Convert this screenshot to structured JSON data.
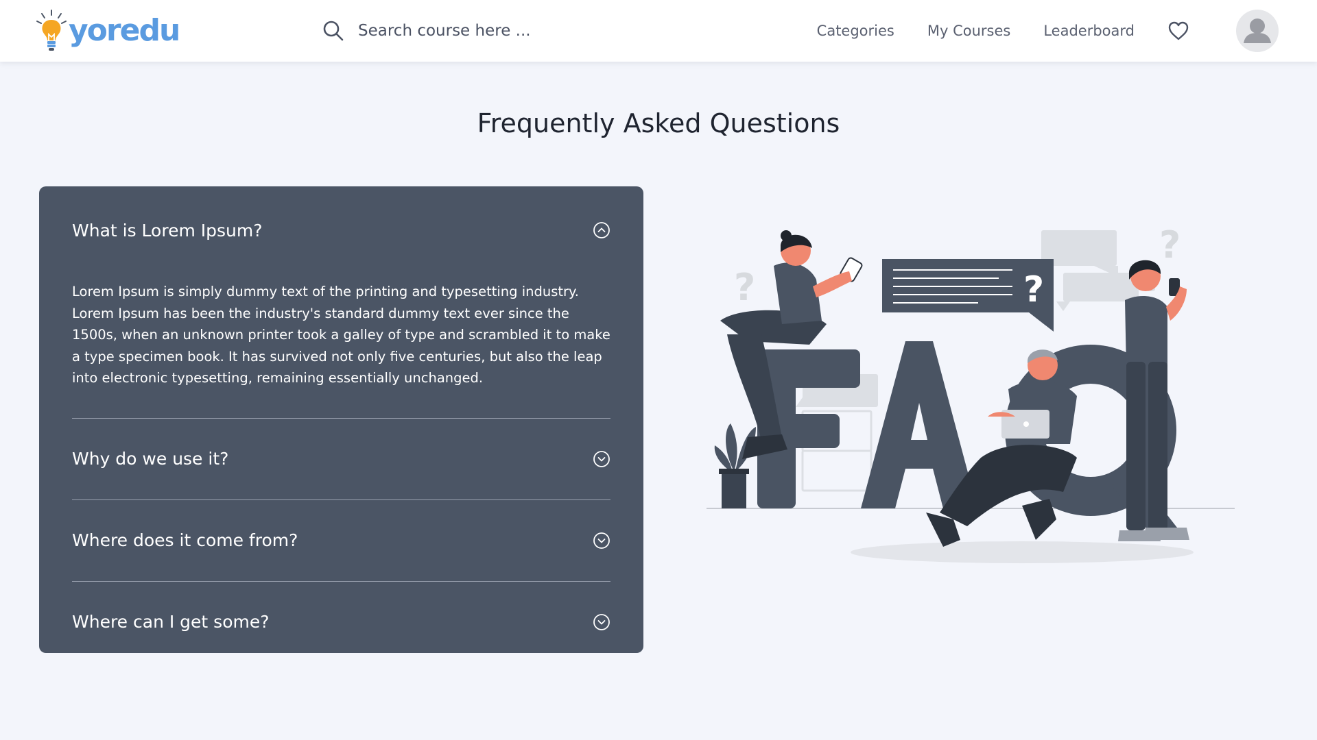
{
  "header": {
    "brand": "yoredu",
    "search_placeholder": "Search course here ...",
    "nav": [
      "Categories",
      "My Courses",
      "Leaderboard"
    ],
    "icons": [
      "search-icon",
      "heart-icon",
      "avatar-icon",
      "bulb-logo-icon"
    ]
  },
  "page": {
    "title": "Frequently Asked Questions"
  },
  "faq": {
    "items": [
      {
        "question": "What is Lorem Ipsum?",
        "answer": "Lorem Ipsum is simply dummy text of the printing and typesetting industry. Lorem Ipsum has been the industry's standard dummy text ever since the 1500s, when an unknown printer took a galley of type and scrambled it to make a type specimen book. It has survived not only five centuries, but also the leap into electronic typesetting, remaining essentially unchanged.",
        "expanded": true
      },
      {
        "question": "Why do we use it?",
        "expanded": false
      },
      {
        "question": "Where does it come from?",
        "expanded": false
      },
      {
        "question": "Where can I get some?",
        "expanded": false
      }
    ]
  },
  "colors": {
    "brand": "#5a9be0",
    "bulb": "#f5a623",
    "panel": "#4b5565",
    "background": "#f3f5fb",
    "illustration_dark": "#4a5463",
    "illustration_accent": "#f08870"
  }
}
